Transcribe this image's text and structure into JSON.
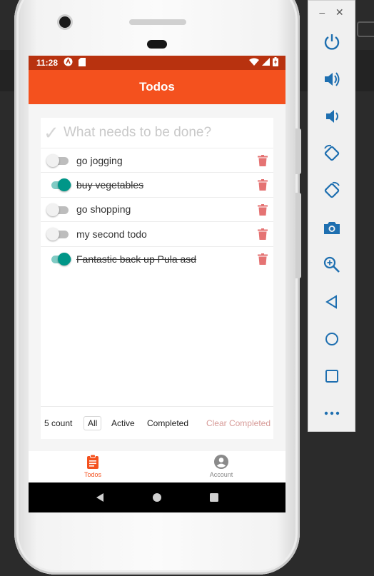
{
  "status_bar": {
    "time": "11:28"
  },
  "app_bar": {
    "title": "Todos"
  },
  "new_todo": {
    "placeholder": "What needs to be done?"
  },
  "todos": [
    {
      "text": "go jogging",
      "completed": false
    },
    {
      "text": "buy vegetables",
      "completed": true
    },
    {
      "text": "go shopping",
      "completed": false
    },
    {
      "text": "my second todo",
      "completed": false
    },
    {
      "text": "Fantastic back up Pula asd",
      "completed": true
    }
  ],
  "footer": {
    "count": "5 count",
    "filters": [
      "All",
      "Active",
      "Completed"
    ],
    "selected_filter": "All",
    "clear_completed": "Clear Completed"
  },
  "bottom_nav": {
    "items": [
      {
        "label": "Todos",
        "icon": "clipboard-icon",
        "active": true
      },
      {
        "label": "Account",
        "icon": "account-circle-icon",
        "active": false
      }
    ]
  },
  "emulator_toolbar": {
    "icons": [
      "power-icon",
      "volume-up-icon",
      "volume-down-icon",
      "rotate-left-icon",
      "rotate-right-icon",
      "camera-icon",
      "zoom-icon",
      "back-icon",
      "home-icon",
      "overview-icon",
      "more-icon"
    ]
  },
  "colors": {
    "app_bar": "#f4511e",
    "status_bar": "#b8320f",
    "toggle_on": "#009688",
    "clear_completed": "#d79a97",
    "trash": "#e57373"
  }
}
